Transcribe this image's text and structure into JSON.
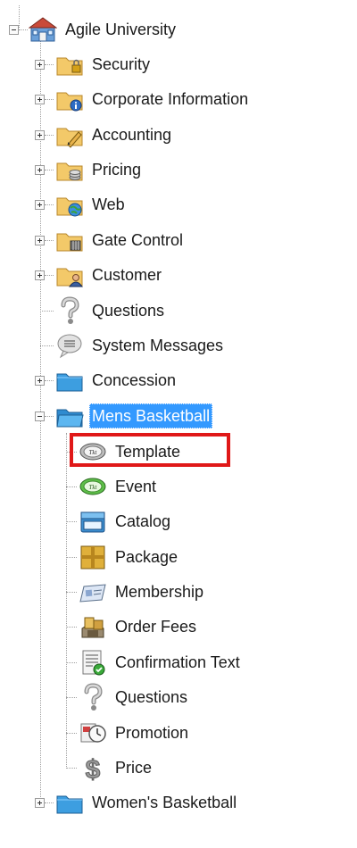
{
  "tree": {
    "root": {
      "label": "Agile University",
      "icon": "school-building-icon"
    },
    "top_items": [
      {
        "label": "Security",
        "icon": "folder-lock-icon",
        "expander": "plus"
      },
      {
        "label": "Corporate Information",
        "icon": "folder-info-icon",
        "expander": "plus"
      },
      {
        "label": "Accounting",
        "icon": "folder-pencil-icon",
        "expander": "plus"
      },
      {
        "label": "Pricing",
        "icon": "folder-coins-icon",
        "expander": "plus"
      },
      {
        "label": "Web",
        "icon": "folder-globe-icon",
        "expander": "plus"
      },
      {
        "label": "Gate Control",
        "icon": "folder-gate-icon",
        "expander": "plus"
      },
      {
        "label": "Customer",
        "icon": "folder-person-icon",
        "expander": "plus"
      },
      {
        "label": "Questions",
        "icon": "question-mark-icon",
        "expander": "none"
      },
      {
        "label": "System Messages",
        "icon": "speech-bubble-icon",
        "expander": "none"
      },
      {
        "label": "Concession",
        "icon": "blue-folder-icon",
        "expander": "plus"
      },
      {
        "label": "Mens Basketball",
        "icon": "blue-folder-open-icon",
        "expander": "minus",
        "selected": true
      }
    ],
    "mens_basketball_children": [
      {
        "label": "Template",
        "icon": "ticket-template-icon"
      },
      {
        "label": "Event",
        "icon": "ticket-event-icon"
      },
      {
        "label": "Catalog",
        "icon": "catalog-box-icon"
      },
      {
        "label": "Package",
        "icon": "package-icon"
      },
      {
        "label": "Membership",
        "icon": "membership-card-icon"
      },
      {
        "label": "Order Fees",
        "icon": "order-fees-icon"
      },
      {
        "label": "Confirmation Text",
        "icon": "confirmation-document-icon"
      },
      {
        "label": "Questions",
        "icon": "question-mark-icon"
      },
      {
        "label": "Promotion",
        "icon": "promotion-clock-icon"
      },
      {
        "label": "Price",
        "icon": "dollar-sign-icon"
      }
    ],
    "bottom_items": [
      {
        "label": "Women's Basketball",
        "icon": "blue-folder-icon",
        "expander": "plus"
      }
    ],
    "highlight_color": "#e01818",
    "selection_color": "#3399ff"
  }
}
